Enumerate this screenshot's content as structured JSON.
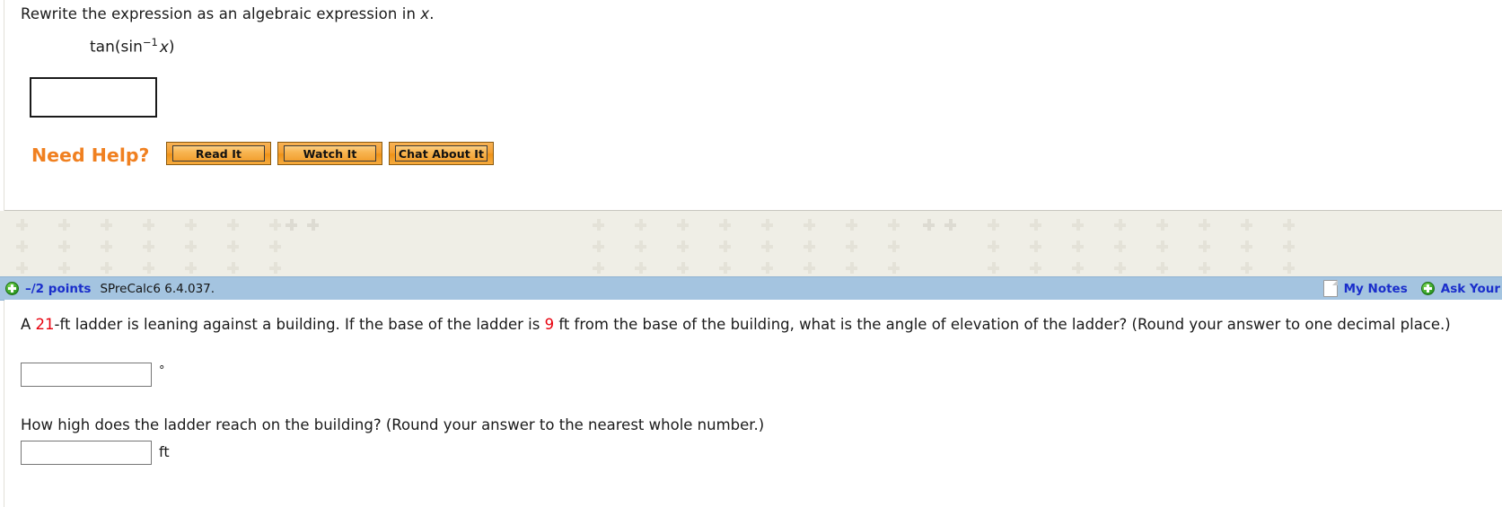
{
  "problem_one": {
    "prompt_before": "Rewrite the expression as an algebraic expression in ",
    "prompt_var": "x",
    "prompt_after": ".",
    "expression_fn": "tan(sin",
    "expression_exp": "−1",
    "expression_var": "x",
    "expression_close": ")",
    "answer_value": "",
    "need_help_label": "Need Help?",
    "buttons": [
      {
        "name": "read-it",
        "label": "Read It"
      },
      {
        "name": "watch-it",
        "label": "Watch It"
      },
      {
        "name": "chat-about-it",
        "label": "Chat About It"
      }
    ]
  },
  "question_header": {
    "points": "–/2 points",
    "question_id": "SPreCalc6 6.4.037.",
    "my_notes_label": "My Notes",
    "ask_teacher_label": "Ask Your",
    "add_icon": "plus-circle-icon",
    "notes_icon": "page-icon"
  },
  "problem_two": {
    "part_a": {
      "text_1": "A ",
      "value_1": "21",
      "text_2": "-ft ladder is leaning against a building. If the base of the ladder is ",
      "value_2": "9",
      "text_3": " ft from the base of the building, what is the angle of elevation of the ladder? (Round your answer to one decimal place.)",
      "answer_value": "",
      "unit": "°"
    },
    "part_b": {
      "text": "How high does the ladder reach on the building? (Round your answer to the nearest whole number.)",
      "answer_value": "",
      "unit": "ft"
    }
  },
  "colors": {
    "accent_orange": "#f08020",
    "header_blue": "#a4c4e0",
    "link_blue": "#1a2ecb",
    "highlight_red": "#e8000d",
    "band_beige": "#efeee6"
  }
}
